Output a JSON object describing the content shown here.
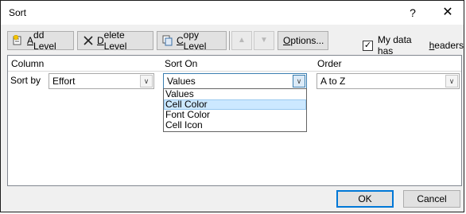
{
  "window": {
    "title": "Sort",
    "help_glyph": "?",
    "close_glyph": "✕"
  },
  "toolbar": {
    "add_level": {
      "prefix": "",
      "underlined": "A",
      "suffix": "dd Level"
    },
    "delete_level": {
      "prefix": "",
      "underlined": "D",
      "suffix": "elete Level"
    },
    "copy_level": {
      "prefix": "",
      "underlined": "C",
      "suffix": "opy Level"
    },
    "move_up_glyph": "▲",
    "move_down_glyph": "▼",
    "options": {
      "prefix": "",
      "underlined": "O",
      "suffix": "ptions..."
    },
    "headers_checkbox": {
      "checked": true,
      "check_glyph": "✓",
      "prefix": "My data has ",
      "underlined": "h",
      "suffix": "eaders"
    }
  },
  "grid": {
    "headers": {
      "column": "Column",
      "sort_on": "Sort On",
      "order": "Order"
    },
    "rows": [
      {
        "label": "Sort by",
        "column": "Effort",
        "sort_on": "Values",
        "order": "A to Z"
      }
    ],
    "dropdown_glyph": "∨"
  },
  "sort_on_dropdown": {
    "open": true,
    "options": [
      "Values",
      "Cell Color",
      "Font Color",
      "Cell Icon"
    ],
    "highlighted": "Cell Color"
  },
  "buttons": {
    "ok": "OK",
    "cancel": "Cancel"
  },
  "colors": {
    "highlight": "#cce8ff",
    "default_button_border": "#0078d7",
    "active_combo_border": "#3c7fb1"
  }
}
